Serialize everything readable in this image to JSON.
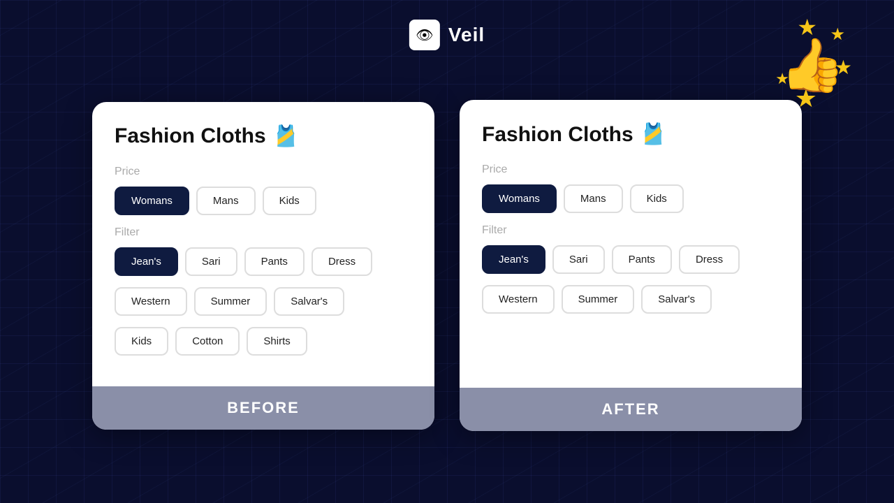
{
  "header": {
    "logo_icon": "👁",
    "logo_label": "Veil"
  },
  "decoration": {
    "stars": [
      "★",
      "★",
      "★",
      "★",
      "★"
    ],
    "thumb": "👍"
  },
  "before_card": {
    "title": "Fashion Cloths",
    "title_emoji": "👕",
    "price_label": "Price",
    "price_buttons": [
      {
        "label": "Womans",
        "active": true
      },
      {
        "label": "Mans",
        "active": false
      },
      {
        "label": "Kids",
        "active": false
      }
    ],
    "filter_label": "Filter",
    "filter_buttons_row1": [
      {
        "label": "Jean's",
        "active": true
      },
      {
        "label": "Sari",
        "active": false
      },
      {
        "label": "Pants",
        "active": false
      },
      {
        "label": "Dress",
        "active": false
      }
    ],
    "filter_buttons_row2": [
      {
        "label": "Western",
        "active": false
      },
      {
        "label": "Summer",
        "active": false
      },
      {
        "label": "Salvar's",
        "active": false
      }
    ],
    "filter_buttons_row3": [
      {
        "label": "Kids",
        "active": false
      },
      {
        "label": "Cotton",
        "active": false
      },
      {
        "label": "Shirts",
        "active": false
      }
    ],
    "footer_label": "BEFORE"
  },
  "after_card": {
    "title": "Fashion Cloths",
    "title_emoji": "👕",
    "price_label": "Price",
    "price_buttons": [
      {
        "label": "Womans",
        "active": true
      },
      {
        "label": "Mans",
        "active": false
      },
      {
        "label": "Kids",
        "active": false
      }
    ],
    "filter_label": "Filter",
    "filter_buttons_row1": [
      {
        "label": "Jean's",
        "active": true
      },
      {
        "label": "Sari",
        "active": false
      },
      {
        "label": "Pants",
        "active": false
      },
      {
        "label": "Dress",
        "active": false
      }
    ],
    "filter_buttons_row2": [
      {
        "label": "Western",
        "active": false
      },
      {
        "label": "Summer",
        "active": false
      },
      {
        "label": "Salvar's",
        "active": false
      }
    ],
    "footer_label": "AFTER"
  }
}
